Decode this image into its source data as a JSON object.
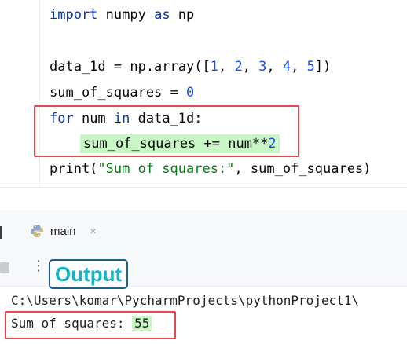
{
  "editor": {
    "line1": {
      "kw1": "import",
      "mid": " numpy ",
      "kw2": "as",
      "end": " np"
    },
    "line3": {
      "a": "data_1d = np.array([",
      "n1": "1",
      "c1": ", ",
      "n2": "2",
      "c2": ", ",
      "n3": "3",
      "c3": ", ",
      "n4": "4",
      "c4": ", ",
      "n5": "5",
      "b": "])"
    },
    "line4": {
      "a": "sum_of_squares = ",
      "n": "0"
    },
    "line5": {
      "kw1": "for",
      "a": " num ",
      "kw2": "in",
      "b": " data_1d:"
    },
    "line6": {
      "a": "sum_of_squares += num**",
      "n": "2"
    },
    "line7": {
      "a": "print(",
      "s": "\"Sum of squares:\"",
      "b": ", sum_of_squares)"
    }
  },
  "run_panel": {
    "tab_label": "main",
    "tab_icon": "python-icon",
    "close_glyph": "×",
    "kebab_glyph": "⋮"
  },
  "annotation": {
    "badge": "Output"
  },
  "console": {
    "path_line": "C:\\Users\\komar\\PycharmProjects\\pythonProject1\\",
    "result_label": "Sum of squares: ",
    "result_value": "55"
  },
  "colors": {
    "highlight_green": "#c8f7c5",
    "annotation_red": "#e5484d",
    "badge_text": "#10b5c8",
    "keyword_blue": "#0033b3",
    "number_blue": "#1750eb",
    "string_green": "#067d17"
  }
}
